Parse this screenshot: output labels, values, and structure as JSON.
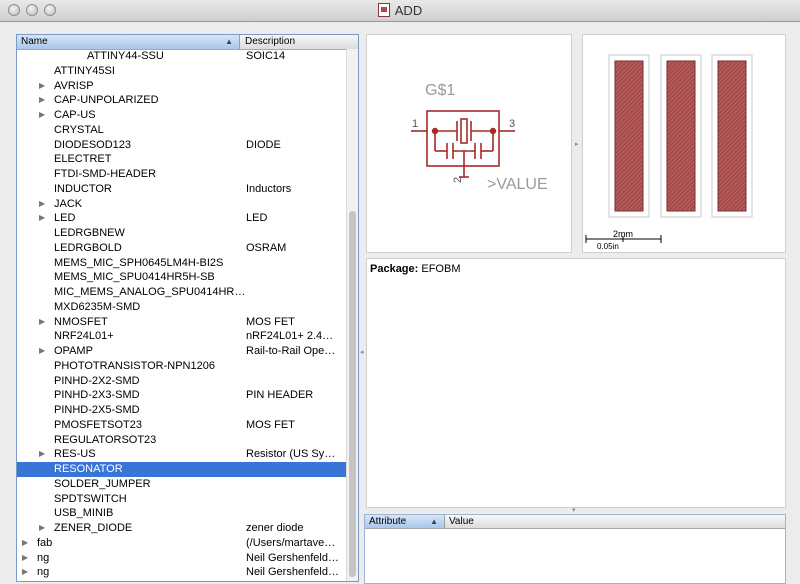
{
  "window": {
    "title": "ADD"
  },
  "tree": {
    "col_name": "Name",
    "col_desc": "Description",
    "rows": [
      {
        "name": "ATTINY44-SSU",
        "desc": "SOIC14",
        "depth": 2,
        "tri": false
      },
      {
        "name": "ATTINY45SI",
        "desc": "",
        "depth": 1,
        "tri": false
      },
      {
        "name": "AVRISP",
        "desc": "",
        "depth": 1,
        "tri": true
      },
      {
        "name": "CAP-UNPOLARIZED",
        "desc": "",
        "depth": 1,
        "tri": true
      },
      {
        "name": "CAP-US",
        "desc": "",
        "depth": 1,
        "tri": true
      },
      {
        "name": "CRYSTAL",
        "desc": "",
        "depth": 1,
        "tri": false
      },
      {
        "name": "DIODESOD123",
        "desc": "DIODE",
        "depth": 1,
        "tri": false
      },
      {
        "name": "ELECTRET",
        "desc": "",
        "depth": 1,
        "tri": false
      },
      {
        "name": "FTDI-SMD-HEADER",
        "desc": "",
        "depth": 1,
        "tri": false
      },
      {
        "name": "INDUCTOR",
        "desc": "Inductors",
        "depth": 1,
        "tri": false
      },
      {
        "name": "JACK",
        "desc": "",
        "depth": 1,
        "tri": true
      },
      {
        "name": "LED",
        "desc": "LED",
        "depth": 1,
        "tri": true
      },
      {
        "name": "LEDRGBNEW",
        "desc": "",
        "depth": 1,
        "tri": false
      },
      {
        "name": "LEDRGBOLD",
        "desc": "OSRAM",
        "depth": 1,
        "tri": false
      },
      {
        "name": "MEMS_MIC_SPH0645LM4H-BI2S",
        "desc": "",
        "depth": 1,
        "tri": false
      },
      {
        "name": "MEMS_MIC_SPU0414HR5H-SB",
        "desc": "",
        "depth": 1,
        "tri": false
      },
      {
        "name": "MIC_MEMS_ANALOG_SPU0414HR…",
        "desc": "",
        "depth": 1,
        "tri": false
      },
      {
        "name": "MXD6235M-SMD",
        "desc": "",
        "depth": 1,
        "tri": false
      },
      {
        "name": "NMOSFET",
        "desc": "MOS FET",
        "depth": 1,
        "tri": true
      },
      {
        "name": "NRF24L01+",
        "desc": "nRF24L01+ 2.4…",
        "depth": 1,
        "tri": false
      },
      {
        "name": "OPAMP",
        "desc": "Rail-to-Rail Ope…",
        "depth": 1,
        "tri": true
      },
      {
        "name": "PHOTOTRANSISTOR-NPN1206",
        "desc": "",
        "depth": 1,
        "tri": false
      },
      {
        "name": "PINHD-2X2-SMD",
        "desc": "",
        "depth": 1,
        "tri": false
      },
      {
        "name": "PINHD-2X3-SMD",
        "desc": "PIN HEADER",
        "depth": 1,
        "tri": false
      },
      {
        "name": "PINHD-2X5-SMD",
        "desc": "",
        "depth": 1,
        "tri": false
      },
      {
        "name": "PMOSFETSOT23",
        "desc": "MOS FET",
        "depth": 1,
        "tri": false
      },
      {
        "name": "REGULATORSOT23",
        "desc": "",
        "depth": 1,
        "tri": false
      },
      {
        "name": "RES-US",
        "desc": "Resistor (US Sym…",
        "depth": 1,
        "tri": true
      },
      {
        "name": "RESONATOR",
        "desc": "",
        "depth": 1,
        "tri": false,
        "selected": true
      },
      {
        "name": "SOLDER_JUMPER",
        "desc": "",
        "depth": 1,
        "tri": false
      },
      {
        "name": "SPDTSWITCH",
        "desc": "",
        "depth": 1,
        "tri": false
      },
      {
        "name": "USB_MINIB",
        "desc": "",
        "depth": 1,
        "tri": false
      },
      {
        "name": "ZENER_DIODE",
        "desc": "zener diode",
        "depth": 1,
        "tri": true
      },
      {
        "name": "fab",
        "desc": "(/Users/martave…",
        "depth": 0,
        "tri": true
      },
      {
        "name": "ng",
        "desc": "Neil Gershenfeld…",
        "depth": 0,
        "tri": true
      },
      {
        "name": "ng",
        "desc": "Neil Gershenfeld…",
        "depth": 0,
        "tri": true
      }
    ]
  },
  "symbol": {
    "name_label": "G$1",
    "value_label": ">VALUE",
    "pin_left": "1",
    "pin_right": "3",
    "pin_bottom": "2",
    "color": "#a52a2a",
    "text_color": "#9a9a9a"
  },
  "package_view": {
    "scale_mm": "2mm",
    "scale_in": "0.05in",
    "pad_color": "#a74a4a"
  },
  "info": {
    "package_label": "Package:",
    "package_value": "EFOBM"
  },
  "attributes": {
    "col_attribute": "Attribute",
    "col_value": "Value"
  },
  "icons": {
    "sort": "sort-ascending-icon",
    "disclosure": "disclosure-triangle-icon"
  }
}
